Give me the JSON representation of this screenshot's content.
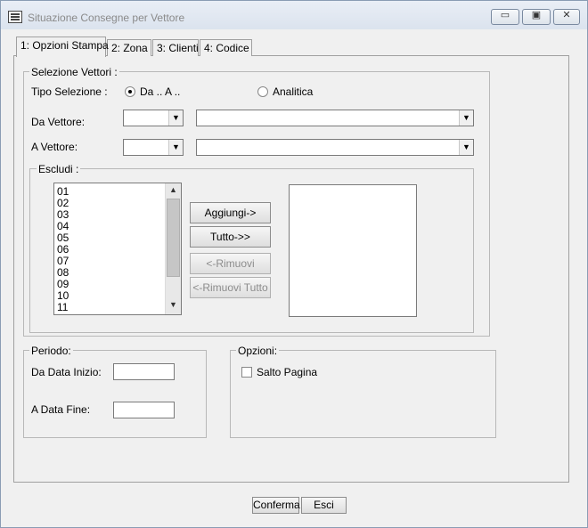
{
  "window": {
    "title": "Situazione Consegne per Vettore"
  },
  "titlebar_buttons": {
    "minimize": "▭",
    "maximize": "▣",
    "close": "✕"
  },
  "tabs": [
    {
      "label": "1: Opzioni Stampa"
    },
    {
      "label": "2: Zona"
    },
    {
      "label": "3: Clienti"
    },
    {
      "label": "4: Codice"
    }
  ],
  "selezione": {
    "legend": "Selezione Vettori :",
    "tipo_label": "Tipo Selezione :",
    "radio_da_a": "Da .. A ..",
    "radio_analitica": "Analitica",
    "da_vettore_label": "Da Vettore:",
    "a_vettore_label": "A Vettore:",
    "da_code_value": "",
    "da_name_value": "",
    "a_code_value": "",
    "a_name_value": ""
  },
  "escludi": {
    "legend": "Escludi :",
    "items": [
      "01",
      "02",
      "03",
      "04",
      "05",
      "06",
      "07",
      "08",
      "09",
      "10",
      "11"
    ],
    "btn_aggiungi": "Aggiungi->",
    "btn_tutto": "Tutto->>",
    "btn_rimuovi": "<-Rimuovi",
    "btn_rimuovi_tutto": "<-Rimuovi Tutto"
  },
  "periodo": {
    "legend": "Periodo:",
    "da_data_label": "Da Data Inizio:",
    "a_data_label": "A Data Fine:",
    "da_data_value": "",
    "a_data_value": ""
  },
  "opzioni": {
    "legend": "Opzioni:",
    "salto_pagina": "Salto Pagina"
  },
  "footer": {
    "conferma": "Conferma",
    "esci": "Esci"
  }
}
